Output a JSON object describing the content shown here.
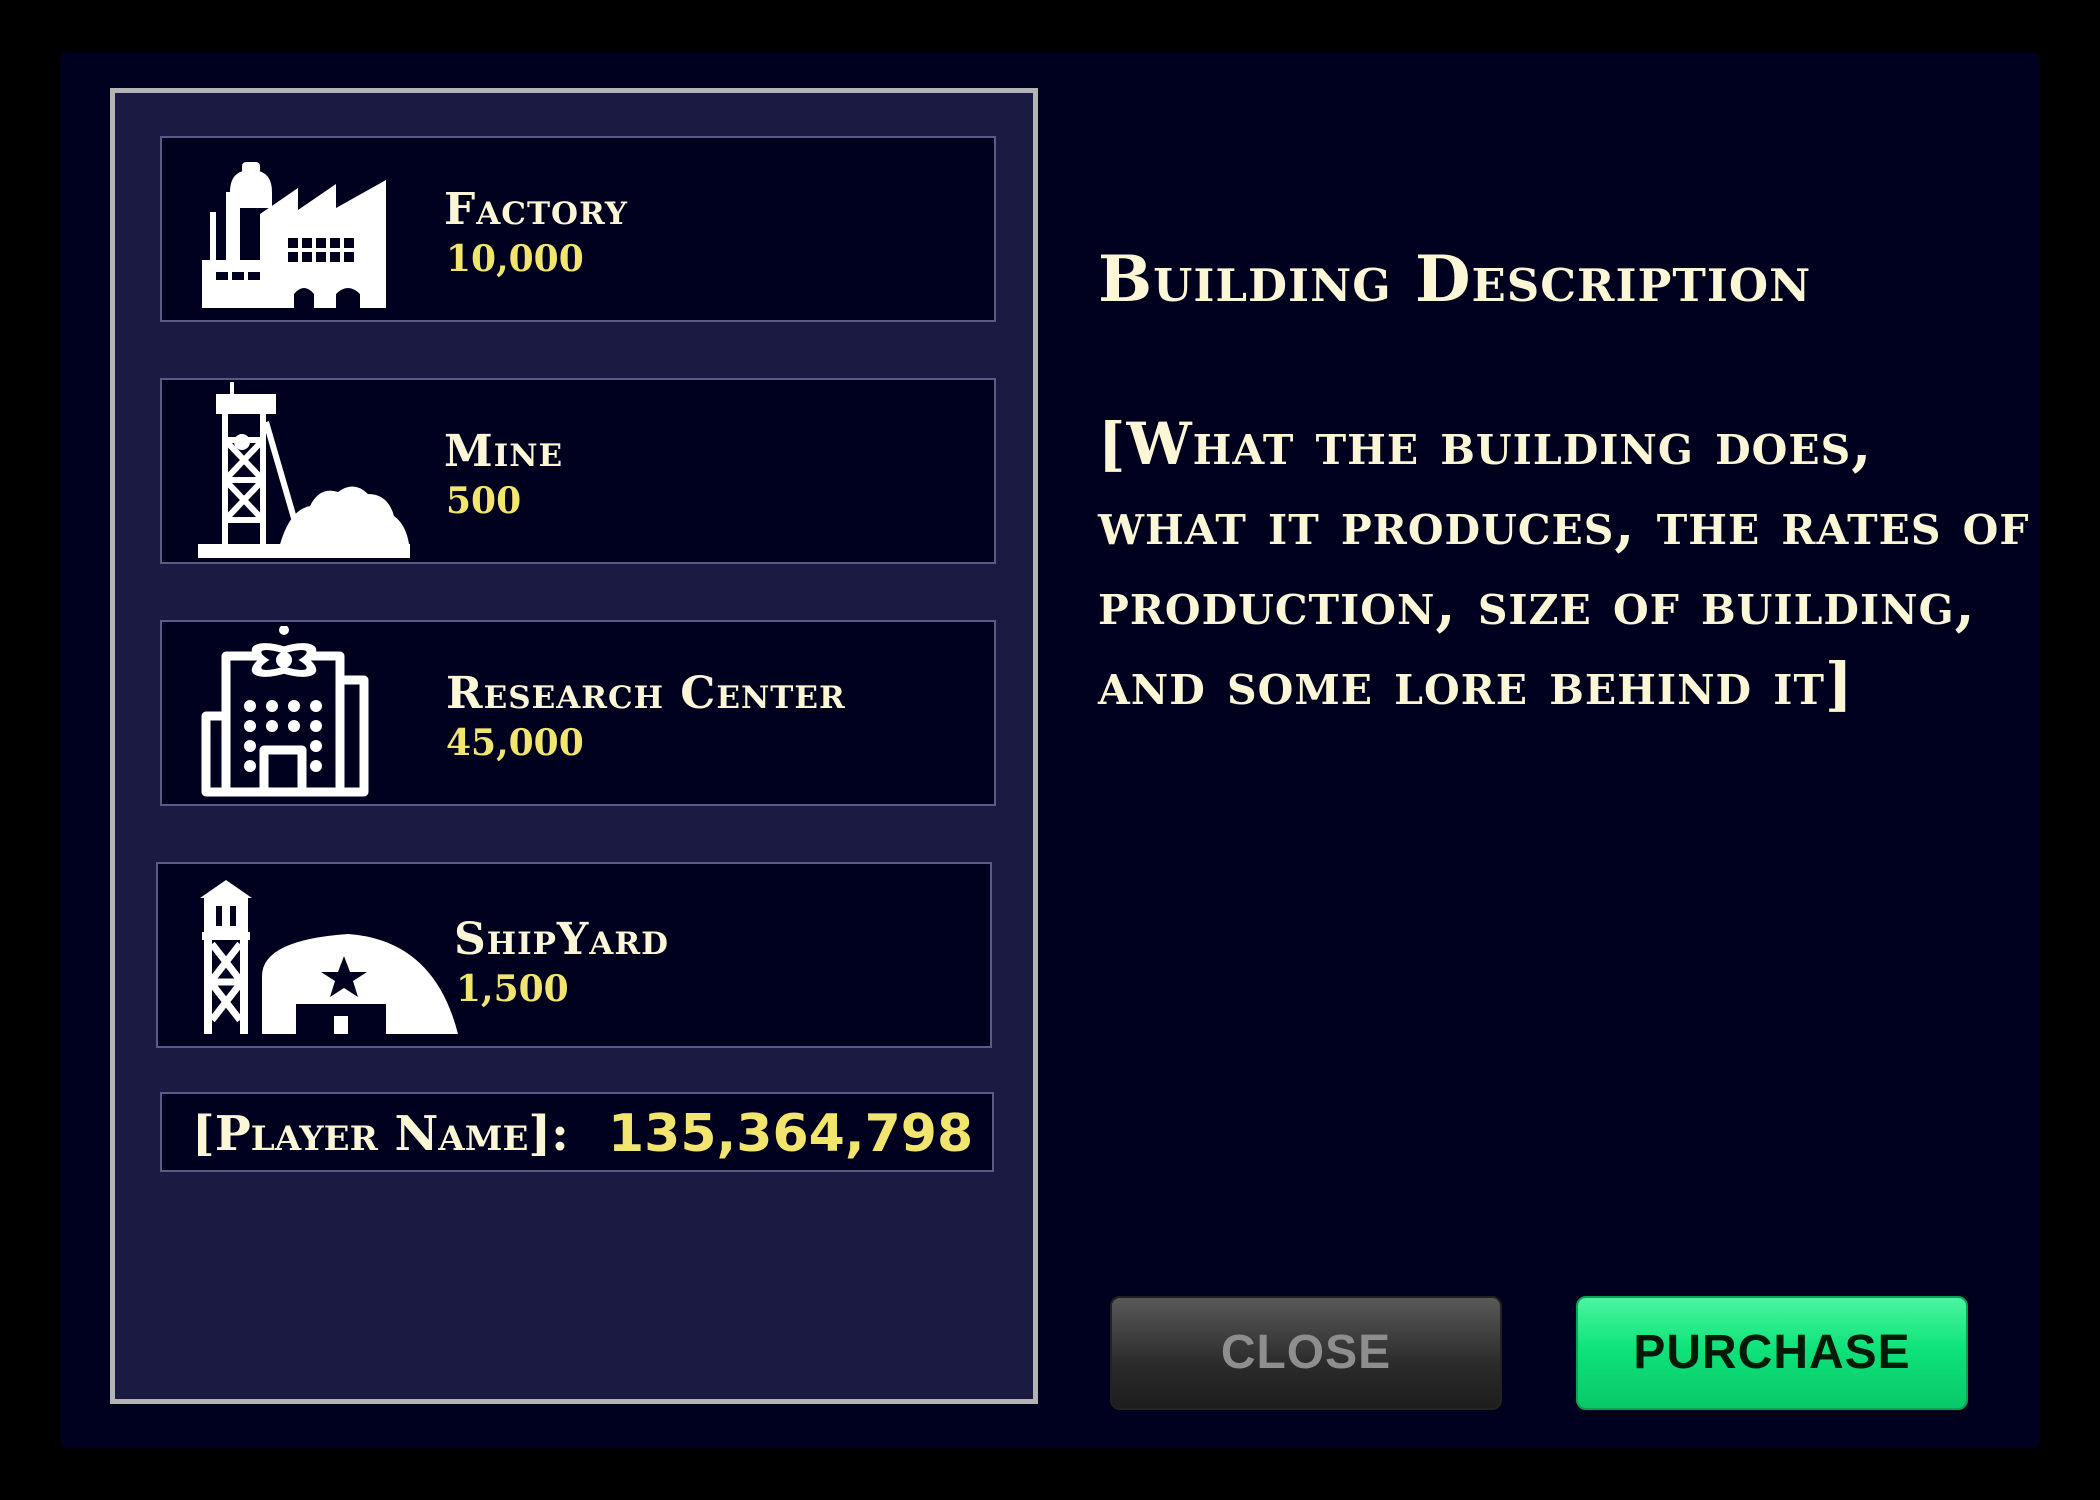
{
  "buildings": [
    {
      "name": "Factory",
      "price": "10,000",
      "icon": "factory-icon"
    },
    {
      "name": "Mine",
      "price": "500",
      "icon": "mine-icon"
    },
    {
      "name": "Research Center",
      "price": "45,000",
      "icon": "research-center-icon"
    },
    {
      "name": "ShipYard",
      "price": "1,500",
      "icon": "shipyard-icon"
    }
  ],
  "player": {
    "name": "[Player Name]:",
    "money": "135,364,798"
  },
  "description": {
    "title": "Building Description",
    "body": "[What the building does, what it produces, the rates of production, size of building, and some lore behind it]"
  },
  "buttons": {
    "close": "CLOSE",
    "purchase": "PURCHASE"
  },
  "colors": {
    "panel": "#00001f",
    "list_bg": "#1a1a42",
    "gold": "#f2e56e",
    "cream": "#fbf6d6",
    "purchase": "#0fe37a"
  }
}
